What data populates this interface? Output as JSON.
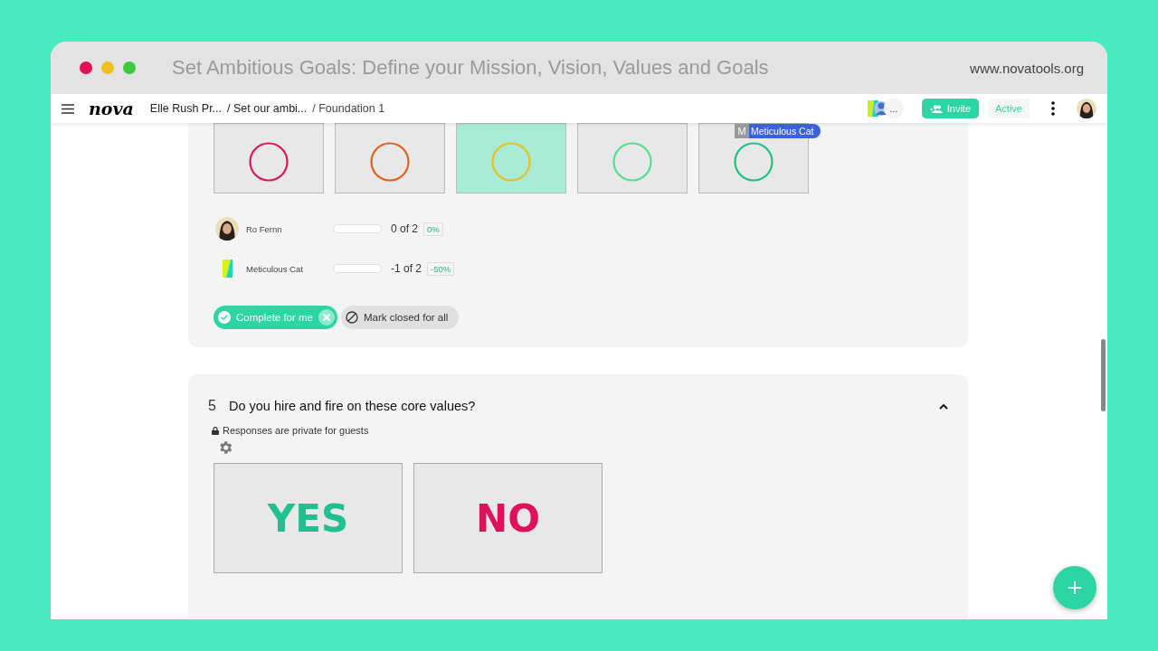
{
  "window": {
    "title": "Set Ambitious Goals: Define your Mission, Vision, Values and Goals",
    "url": "www.novatools.org"
  },
  "nav": {
    "logo": "nova",
    "breadcrumbs": [
      "Elle Rush Pr...",
      "/ Set our ambi...",
      "/ Foundation 1"
    ],
    "more_people": "...",
    "invite": "Invite",
    "status": "Active"
  },
  "rating": {
    "options": [
      {
        "color": "#d9185c",
        "selected": false
      },
      {
        "color": "#e0601a",
        "selected": false
      },
      {
        "color": "#e8c020",
        "selected": true
      },
      {
        "color": "#50e090",
        "selected": false
      },
      {
        "color": "#20c080",
        "selected": false,
        "tag": {
          "initial": "M",
          "name": "Meticulous Cat"
        }
      }
    ],
    "participants": [
      {
        "kind": "photo",
        "name": "Ro Fernn",
        "level": 0,
        "progress": "0 of 2",
        "percent": "0%"
      },
      {
        "kind": "pattern",
        "name": "Meticulous Cat",
        "level": 0,
        "progress": "-1 of 2",
        "percent": "-50%"
      }
    ],
    "complete_button": "Complete for me",
    "close_button": "Mark closed for all"
  },
  "question": {
    "number": "5",
    "title": "Do you hire and fire on these core values?",
    "expanded": true,
    "privacy_note": "Responses are private for guests",
    "options": [
      {
        "label": "YES",
        "color": "#20c090"
      },
      {
        "label": "NO",
        "color": "#e0105a"
      }
    ]
  }
}
